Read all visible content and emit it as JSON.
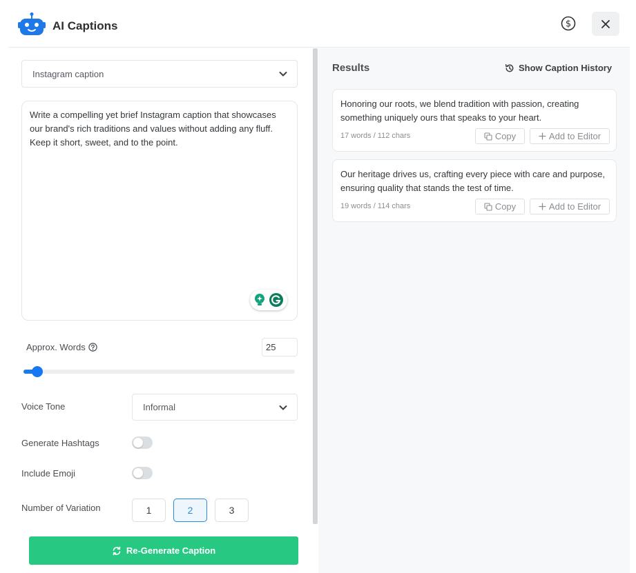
{
  "header": {
    "title": "AI Captions",
    "icons": {
      "logo": "robot-icon",
      "pricing": "dollar-circle-icon",
      "close": "close-icon"
    }
  },
  "form": {
    "caption_type": {
      "selected": "Instagram caption"
    },
    "prompt": {
      "value": "Write a compelling yet brief Instagram caption that showcases our brand's rich traditions and values without adding any fluff. Keep it short, sweet, and to the point."
    },
    "approx_words": {
      "label": "Approx. Words",
      "value": "25",
      "slider_fraction": 0.05
    },
    "voice_tone": {
      "label": "Voice Tone",
      "selected": "Informal"
    },
    "hashtags": {
      "label": "Generate Hashtags",
      "enabled": false
    },
    "emoji": {
      "label": "Include Emoji",
      "enabled": false
    },
    "variations": {
      "label": "Number of Variation",
      "options": [
        "1",
        "2",
        "3"
      ],
      "selected": "2"
    },
    "regenerate_label": "Re-Generate Caption"
  },
  "results": {
    "title": "Results",
    "history_label": "Show Caption History",
    "items": [
      {
        "text": "Honoring our roots, we blend tradition with passion, creating something uniquely ours that speaks to your heart.",
        "meta": "17 words / 112 chars",
        "copy_label": "Copy",
        "add_label": "Add to Editor"
      },
      {
        "text": "Our heritage drives us, crafting every piece with care and purpose, ensuring quality that stands the test of time.",
        "meta": "19 words / 114 chars",
        "copy_label": "Copy",
        "add_label": "Add to Editor"
      }
    ]
  },
  "colors": {
    "accent": "#1877f2",
    "primary_button": "#27c982",
    "selected_variation": "#2b88d8"
  }
}
